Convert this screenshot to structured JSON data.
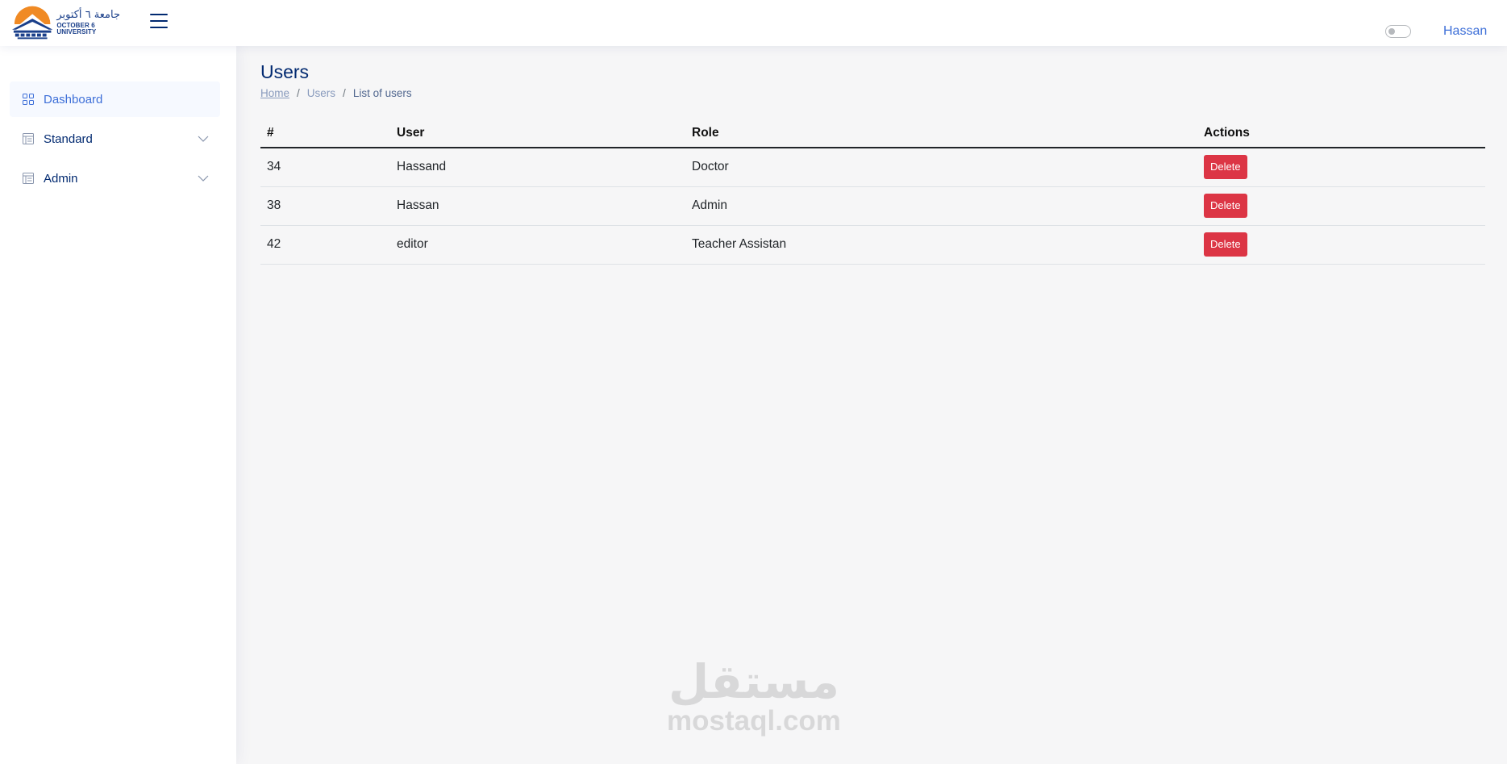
{
  "header": {
    "logo": {
      "arabic": "جامعة ٦ أكتوبر",
      "english": "OCTOBER 6 UNIVERSITY"
    },
    "user_name": "Hassan",
    "theme_toggle": "off"
  },
  "sidebar": {
    "items": [
      {
        "label": "Dashboard",
        "icon": "grid-icon",
        "active": true,
        "expandable": false
      },
      {
        "label": "Standard",
        "icon": "layout-text-icon",
        "active": false,
        "expandable": true
      },
      {
        "label": "Admin",
        "icon": "layout-text-icon",
        "active": false,
        "expandable": true
      }
    ]
  },
  "page": {
    "title": "Users",
    "breadcrumb": {
      "home": "Home",
      "users": "Users",
      "current": "List of users",
      "separator": "/"
    }
  },
  "table": {
    "headers": [
      "#",
      "User",
      "Role",
      "Actions"
    ],
    "rows": [
      {
        "id": "34",
        "user": "Hassand",
        "role": "Doctor",
        "action": "Delete"
      },
      {
        "id": "38",
        "user": "Hassan",
        "role": "Admin",
        "action": "Delete"
      },
      {
        "id": "42",
        "user": "editor",
        "role": "Teacher Assistan",
        "action": "Delete"
      }
    ]
  },
  "watermark": {
    "arabic": "مستقل",
    "latin": "mostaql.com"
  },
  "colors": {
    "brand": "#012970",
    "link": "#3d6fd8",
    "danger": "#dc3545",
    "logo_orange": "#f08a24"
  }
}
